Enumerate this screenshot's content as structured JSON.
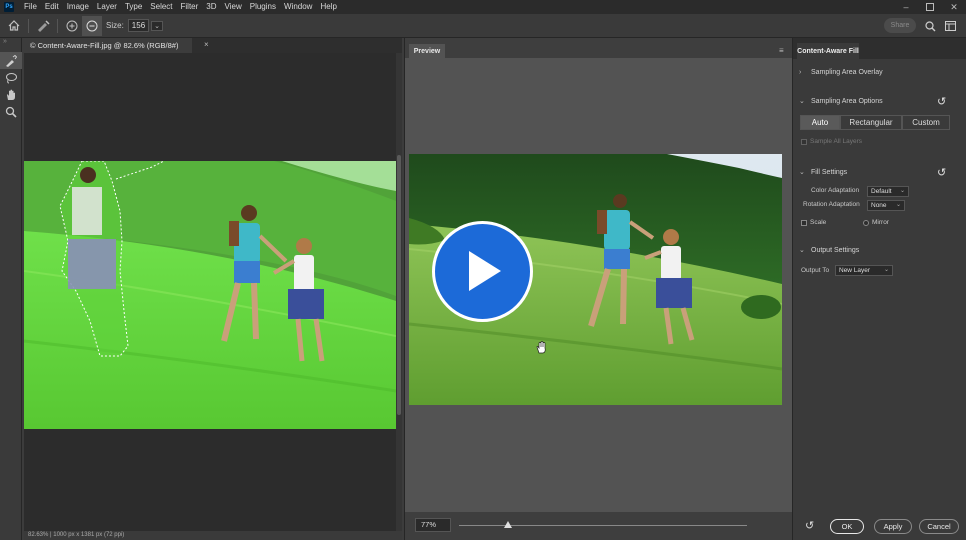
{
  "menubar": {
    "logo": "Ps",
    "items": [
      "File",
      "Edit",
      "Image",
      "Layer",
      "Type",
      "Select",
      "Filter",
      "3D",
      "View",
      "Plugins",
      "Window",
      "Help"
    ]
  },
  "options_bar": {
    "size_label": "Size:",
    "size_value": "156",
    "share_label": "Share"
  },
  "document": {
    "tab_title": "© Content-Aware-Fill.jpg @ 82.6% (RGB/8#)",
    "close_glyph": "×",
    "status": "82.63%   |   1000 px x 1381 px (72 ppi)"
  },
  "preview": {
    "tab_label": "Preview",
    "zoom_value": "77%",
    "zoom_fraction": 0.17
  },
  "caf": {
    "tab_label": "Content-Aware Fill",
    "sampling_overlay": "Sampling Area Overlay",
    "sampling_options": "Sampling Area Options",
    "seg_auto": "Auto",
    "seg_rect": "Rectangular",
    "seg_custom": "Custom",
    "sample_all_layers": "Sample All Layers",
    "fill_settings": "Fill Settings",
    "color_adaptation_label": "Color Adaptation",
    "color_adaptation_value": "Default",
    "rotation_adaptation_label": "Rotation Adaptation",
    "rotation_adaptation_value": "None",
    "scale_label": "Scale",
    "mirror_label": "Mirror",
    "output_settings": "Output Settings",
    "output_to_label": "Output To",
    "output_to_value": "New Layer",
    "ok": "OK",
    "apply": "Apply",
    "cancel": "Cancel"
  },
  "colors": {
    "accent_blue": "#1c6ad8",
    "overlay_green": "#5fd23a"
  }
}
